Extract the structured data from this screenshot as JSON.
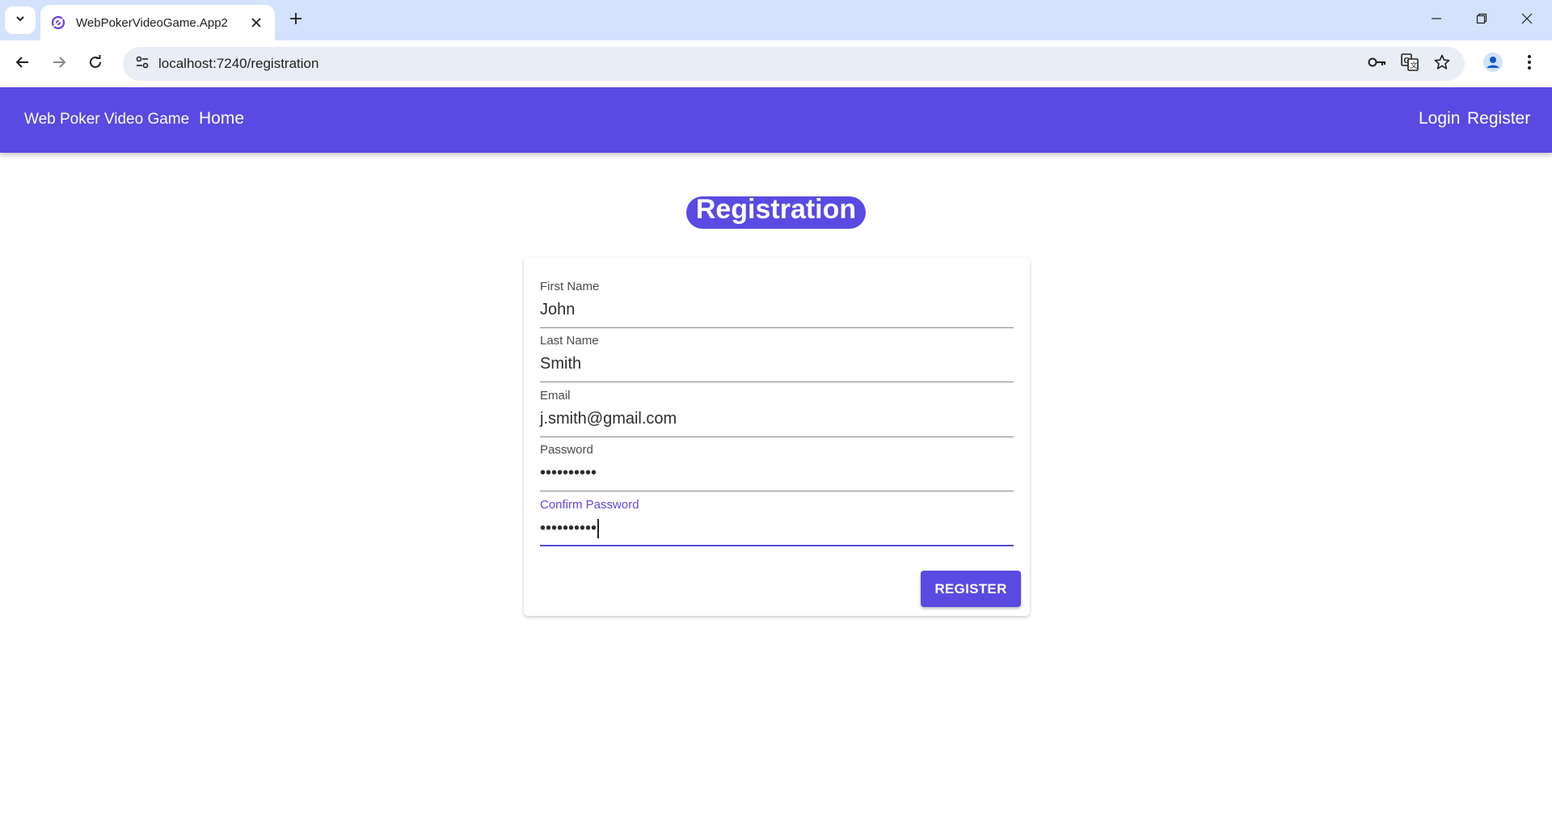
{
  "browser": {
    "tab_title": "WebPokerVideoGame.App2",
    "url": "localhost:7240/registration",
    "icons": {
      "tab_search": "chevron-down-icon",
      "favicon": "blazor-favicon-icon",
      "tab_close": "close-icon",
      "new_tab": "plus-icon",
      "minimize": "minimize-icon",
      "restore": "restore-icon",
      "close_window": "close-icon",
      "back": "arrow-left-icon",
      "forward": "arrow-right-icon",
      "reload": "reload-icon",
      "site_info": "tune-icon",
      "password": "key-icon",
      "translate": "translate-icon",
      "bookmark": "star-icon",
      "profile": "profile-icon",
      "menu": "kebab-menu-icon"
    }
  },
  "appbar": {
    "brand": "Web Poker Video Game",
    "home": "Home",
    "login": "Login",
    "register": "Register",
    "color": "#594ae2"
  },
  "page": {
    "title": "Registration"
  },
  "form": {
    "first_name": {
      "label": "First Name",
      "value": "John"
    },
    "last_name": {
      "label": "Last Name",
      "value": "Smith"
    },
    "email": {
      "label": "Email",
      "value": "j.smith@gmail.com"
    },
    "password": {
      "label": "Password",
      "value": "••••••••••"
    },
    "confirm_password": {
      "label": "Confirm Password",
      "value": "••••••••••"
    },
    "submit_label": "REGISTER"
  }
}
